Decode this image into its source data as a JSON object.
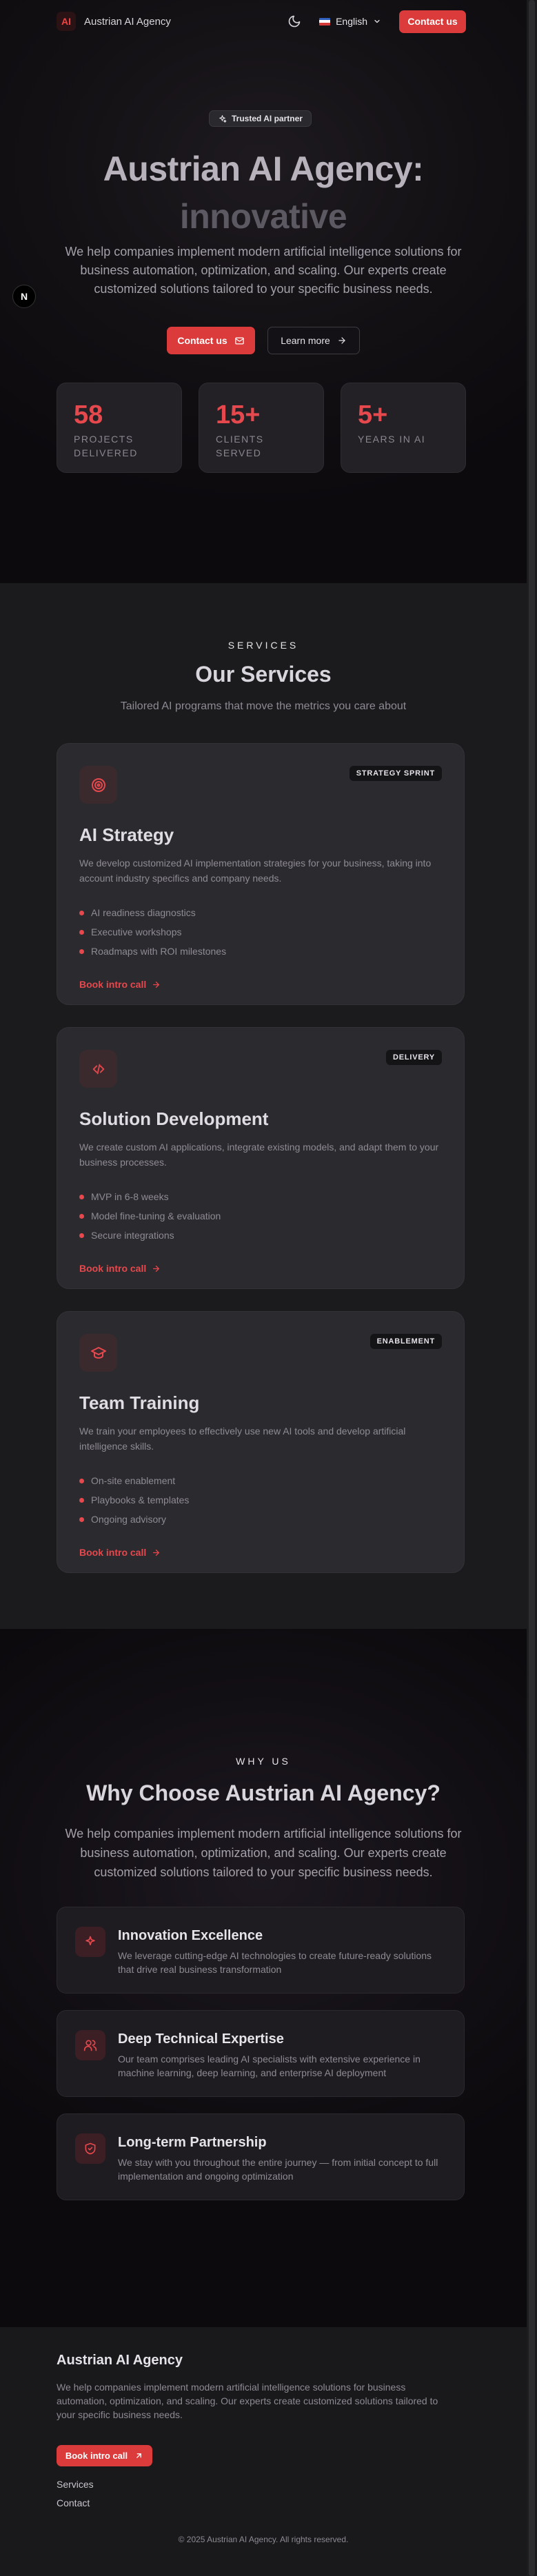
{
  "nav": {
    "logo_text": "AI",
    "brand": "Austrian AI Agency",
    "language": "English",
    "contact": "Contact us"
  },
  "hero": {
    "pill": "Trusted AI partner",
    "title_line1": "Austrian AI Agency:",
    "title_line2": "innovative",
    "subtitle": "We help companies implement modern artificial intelligence solutions for business automation, optimization, and scaling. Our experts create customized solutions tailored to your specific business needs.",
    "cta_primary": "Contact us",
    "cta_secondary": "Learn more",
    "side_icon_text": "N",
    "stats": [
      {
        "value": "58",
        "label": "Projects delivered"
      },
      {
        "value": "15+",
        "label": "Clients served"
      },
      {
        "value": "5+",
        "label": "Years in AI"
      }
    ]
  },
  "services": {
    "eyebrow": "SERVICES",
    "title": "Our Services",
    "subtitle": "Tailored AI programs that move the metrics you care about",
    "cards": [
      {
        "icon": "target-icon",
        "badge": "STRATEGY SPRINT",
        "title": "AI Strategy",
        "description": "We develop customized AI implementation strategies for your business, taking into account industry specifics and company needs.",
        "features": [
          "AI readiness diagnostics",
          "Executive workshops",
          "Roadmaps with ROI milestones"
        ],
        "link": "Book intro call"
      },
      {
        "icon": "code-icon",
        "badge": "DELIVERY",
        "title": "Solution Development",
        "description": "We create custom AI applications, integrate existing models, and adapt them to your business processes.",
        "features": [
          "MVP in 6-8 weeks",
          "Model fine-tuning & evaluation",
          "Secure integrations"
        ],
        "link": "Book intro call"
      },
      {
        "icon": "graduation-cap-icon",
        "badge": "ENABLEMENT",
        "title": "Team Training",
        "description": "We train your employees to effectively use new AI tools and develop artificial intelligence skills.",
        "features": [
          "On-site enablement",
          "Playbooks & templates",
          "Ongoing advisory"
        ],
        "link": "Book intro call"
      }
    ]
  },
  "why": {
    "eyebrow": "WHY US",
    "title": "Why Choose Austrian AI Agency?",
    "subtitle": "We help companies implement modern artificial intelligence solutions for business automation, optimization, and scaling. Our experts create customized solutions tailored to your specific business needs.",
    "items": [
      {
        "icon": "sparkle-icon",
        "title": "Innovation Excellence",
        "description": "We leverage cutting-edge AI technologies to create future-ready solutions that drive real business transformation"
      },
      {
        "icon": "users-icon",
        "title": "Deep Technical Expertise",
        "description": "Our team comprises leading AI specialists with extensive experience in machine learning, deep learning, and enterprise AI deployment"
      },
      {
        "icon": "shield-check-icon",
        "title": "Long-term Partnership",
        "description": "We stay with you throughout the entire journey — from initial concept to full implementation and ongoing optimization"
      }
    ]
  },
  "footer": {
    "title": "Austrian AI Agency",
    "description": "We help companies implement modern artificial intelligence solutions for business automation, optimization, and scaling. Our experts create customized solutions tailored to your specific business needs.",
    "cta": "Book intro call",
    "links": [
      "Services",
      "Contact"
    ],
    "copyright": "© 2025 Austrian AI Agency. All rights reserved."
  },
  "colors": {
    "accent": "#dc3b3b",
    "background": "#0d0b0e",
    "card": "#2b2a2e"
  }
}
